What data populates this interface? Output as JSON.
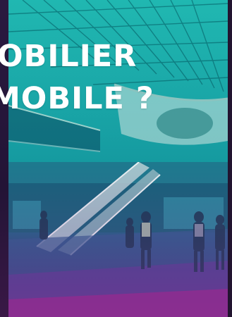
{
  "headline": {
    "line1": "OBILIER",
    "line2": "MOBILE ?"
  },
  "colors": {
    "teal": "#17a3a5",
    "purple_frame": "#2a1a3e",
    "magenta": "#9a2a8c",
    "text": "#ffffff"
  }
}
